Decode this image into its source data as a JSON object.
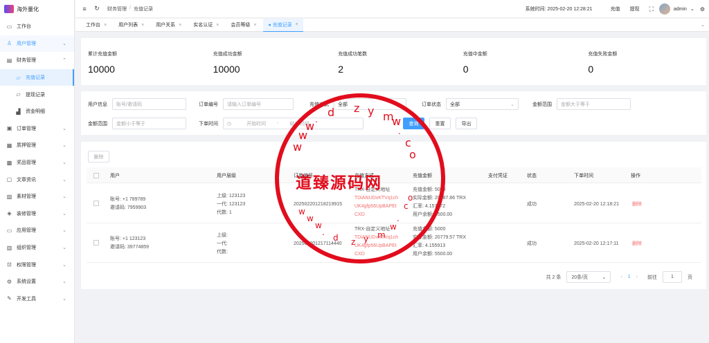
{
  "app": {
    "name": "海外量化"
  },
  "sidebar": {
    "items": [
      {
        "label": "工作台",
        "icon": "monitor-icon",
        "glyph": "▭"
      },
      {
        "label": "用户管理",
        "icon": "user-icon",
        "glyph": "♙",
        "chevron": "⌄"
      },
      {
        "label": "财务管理",
        "icon": "wallet-icon",
        "glyph": "▤",
        "chevron": "⌃"
      },
      {
        "label": "充值记录",
        "icon": "folder-icon",
        "glyph": "▱"
      },
      {
        "label": "提现记录",
        "icon": "folder-icon",
        "glyph": "▱"
      },
      {
        "label": "资金明细",
        "icon": "chart-icon",
        "glyph": "▟"
      },
      {
        "label": "订单管理",
        "icon": "order-icon",
        "glyph": "▣",
        "chevron": "⌄"
      },
      {
        "label": "质押管理",
        "icon": "stake-icon",
        "glyph": "▦",
        "chevron": "⌄"
      },
      {
        "label": "奖品管理",
        "icon": "gift-icon",
        "glyph": "▩",
        "chevron": "⌄"
      },
      {
        "label": "文章资讯",
        "icon": "article-icon",
        "glyph": "▢",
        "chevron": "⌄"
      },
      {
        "label": "素材管理",
        "icon": "image-icon",
        "glyph": "▧",
        "chevron": "⌄"
      },
      {
        "label": "装修管理",
        "icon": "decor-icon",
        "glyph": "◈",
        "chevron": "⌄"
      },
      {
        "label": "应用管理",
        "icon": "app-icon",
        "glyph": "▭",
        "chevron": "⌄"
      },
      {
        "label": "组织管理",
        "icon": "org-icon",
        "glyph": "▥",
        "chevron": "⌄"
      },
      {
        "label": "权限管理",
        "icon": "lock-icon",
        "glyph": "⊡",
        "chevron": "⌄"
      },
      {
        "label": "系统设置",
        "icon": "gear-icon",
        "glyph": "⚙",
        "chevron": "⌄"
      },
      {
        "label": "开发工具",
        "icon": "tool-icon",
        "glyph": "✎",
        "chevron": "⌄"
      }
    ]
  },
  "topbar": {
    "menu_glyph": "≡",
    "refresh_glyph": "↻",
    "breadcrumb": [
      "财务管理",
      "充值记录"
    ],
    "breadcrumb_sep": "/",
    "system_time": "系统时间: 2025-02-20 12:28:21",
    "recharge": "充值",
    "withdraw": "提现",
    "fullscreen_glyph": "⛶",
    "user": "admin",
    "user_chevron": "⌄",
    "settings_glyph": "⚙"
  },
  "tabs": [
    {
      "label": "工作台"
    },
    {
      "label": "用户列表"
    },
    {
      "label": "用户关系"
    },
    {
      "label": "实名认证"
    },
    {
      "label": "会员等级"
    },
    {
      "label": "● 充值记录",
      "active": true
    }
  ],
  "tabs_close": "×",
  "tabs_more": "⌄",
  "stats": [
    {
      "label": "累计充值金额",
      "value": "10000"
    },
    {
      "label": "充值成功金额",
      "value": "10000"
    },
    {
      "label": "充值成功笔数",
      "value": "2"
    },
    {
      "label": "充值中金额",
      "value": "0"
    },
    {
      "label": "充值失败金额",
      "value": "0"
    }
  ],
  "filters": {
    "user_info": {
      "label": "用户信息",
      "placeholder": "账号/邀请码"
    },
    "order_no": {
      "label": "订单编号",
      "placeholder": "请输入订单编号"
    },
    "recharge_method": {
      "label": "充值方式",
      "value": "全部"
    },
    "order_status": {
      "label": "订单状态",
      "value": "全部"
    },
    "amount_range": {
      "label": "金额范围",
      "placeholder": "金额大于等于"
    },
    "amount_range2": {
      "label": "金额范围",
      "placeholder": "金额小于等于"
    },
    "order_time": {
      "label": "下单时间",
      "start": "开始时间",
      "sep": "-",
      "end": "结束时间"
    },
    "search": "查询",
    "reset": "重置",
    "export": "导出",
    "dropdown_glyph": "⌄",
    "clock_glyph": "◷"
  },
  "table": {
    "delete_btn": "删除",
    "headers": [
      "用户",
      "用户层级",
      "订单编号",
      "充值方式",
      "充值金额",
      "支付凭证",
      "状态",
      "下单时间",
      "操作"
    ],
    "rows": [
      {
        "account": "账号: +1 789789",
        "invite": "邀请码: 7959903",
        "level1": "上级: 123123",
        "level2": "一代: 123123",
        "level3": "代数: 1",
        "order_no": "20250220121821991​5",
        "method": "TRX-自定义地址",
        "addr1": "TDiANUDvKTVq1ch",
        "addr2": "UK4gfp56UpBAPEt",
        "addr3": "CXD",
        "amt1": "充值金额: 5000",
        "amt2": "实际金额: 20787.86 TRX",
        "amt3": "汇率: 4.157572",
        "amt4": "用户余额: 5500.00",
        "status": "成功",
        "time": "2025-02-20 12:18:21",
        "action": "删除"
      },
      {
        "account": "账号: +1 123123",
        "invite": "邀请码: 39774859",
        "level1": "上级:",
        "level2": "一代:",
        "level3": "代数:",
        "order_no": "20250220121711444​0",
        "method": "TRX-自定义地址",
        "addr1": "TDiANUDvKTVq1ch",
        "addr2": "UK4gfp56UpBAPEt",
        "addr3": "CXD",
        "amt1": "充值金额: 5000",
        "amt2": "实际金额: 20779.57 TRX",
        "amt3": "汇率: 4.155913",
        "amt4": "用户余额: 5500.00",
        "status": "成功",
        "time": "2025-02-20 12:17:11",
        "action": "删除"
      }
    ]
  },
  "pagination": {
    "total": "共 2 条",
    "page_size": "20条/页",
    "prev": "‹",
    "current": "1",
    "next": "›",
    "goto": "前往",
    "goto_value": "1",
    "page_unit": "页"
  },
  "watermark": {
    "text": "道臻源码网",
    "url_letters": "www.dzymw.com"
  }
}
